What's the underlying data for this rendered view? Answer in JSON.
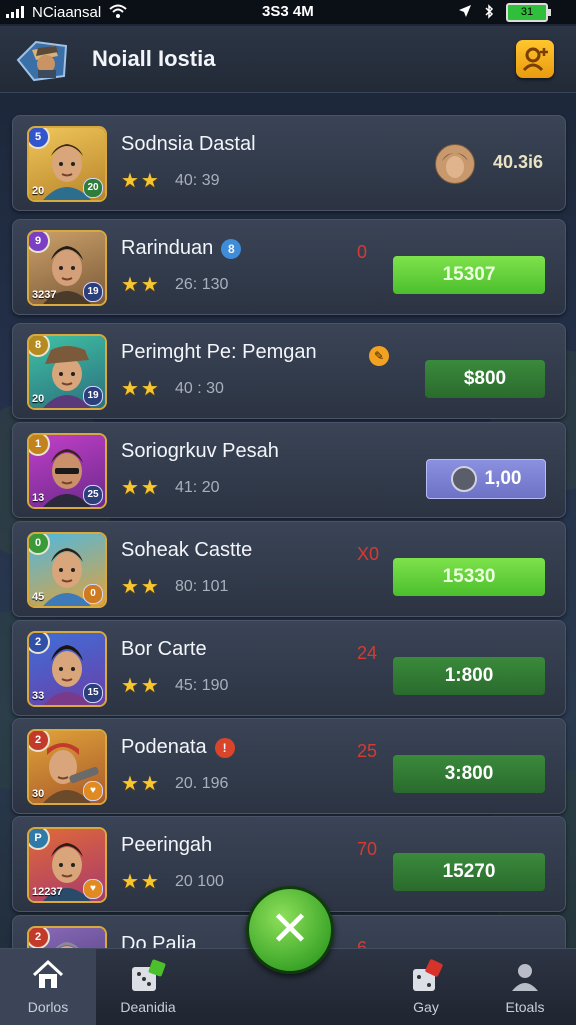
{
  "status_bar": {
    "carrier": "NCiaansal",
    "time": "3S3 4M",
    "battery": "31"
  },
  "header": {
    "title": "Noiall Iostia",
    "profile_icon": "user-icon"
  },
  "rows": [
    {
      "name": "Sodnsia Dastal",
      "stars": "★★",
      "score": "40: 39",
      "level": "5",
      "av_left": "20",
      "av_right": "20",
      "change": "",
      "action": "40.3i6",
      "action_style": "plain",
      "tag": ""
    },
    {
      "name": "Rarinduan",
      "stars": "★★",
      "score": "26: 130",
      "level": "9",
      "av_left": "3237",
      "av_right": "19",
      "change": "0",
      "action": "15307",
      "action_style": "bright",
      "tag": "8"
    },
    {
      "name": "Perimght Pe: Pemgan",
      "stars": "★★",
      "score": "40 : 30",
      "level": "8",
      "av_left": "20",
      "av_right": "19",
      "change": "",
      "action": "$800",
      "action_style": "dark",
      "tag": "✎"
    },
    {
      "name": "Soriogrkuv Pesah",
      "stars": "★★",
      "score": "41: 20",
      "level": "1",
      "av_left": "13",
      "av_right": "25",
      "change": "",
      "action": "1,00",
      "action_style": "purple",
      "tag": ""
    },
    {
      "name": "Soheak Castte",
      "stars": "★★",
      "score": "80: 101",
      "level": "0",
      "av_left": "45",
      "av_right": "0",
      "change": "X0",
      "action": "15330",
      "action_style": "bright",
      "tag": ""
    },
    {
      "name": "Bor Carte",
      "stars": "★★",
      "score": "45: 190",
      "level": "2",
      "av_left": "33",
      "av_right": "15",
      "change": "24",
      "action": "1:800",
      "action_style": "dark",
      "tag": ""
    },
    {
      "name": "Podenata",
      "stars": "★★",
      "score": "20. 196",
      "level": "2",
      "av_left": "30",
      "av_right": "♥",
      "change": "25",
      "action": "3:800",
      "action_style": "dark",
      "tag": "!"
    },
    {
      "name": "Peeringah",
      "stars": "★★",
      "score": "20 100",
      "level": "P",
      "av_left": "12237",
      "av_right": "♥",
      "change": "70",
      "action": "15270",
      "action_style": "dark",
      "tag": ""
    },
    {
      "name": "Do Palia",
      "stars": "",
      "score": "",
      "level": "2",
      "av_left": "",
      "av_right": "",
      "change": "6",
      "action": "",
      "action_style": "none",
      "tag": ""
    }
  ],
  "fab": {
    "icon": "close-icon",
    "glyph": "✕"
  },
  "nav": [
    {
      "label": "Dorlos",
      "icon": "home-icon",
      "active": true
    },
    {
      "label": "Deanidia",
      "icon": "dice-icon",
      "active": false
    },
    {
      "label": "Gay",
      "icon": "gift-box-icon",
      "active": false
    },
    {
      "label": "Etoals",
      "icon": "person-icon",
      "active": false
    }
  ],
  "colors": {
    "accent_green": "#5ccf34",
    "gold": "#f7c630",
    "loss_red": "#d53b33",
    "profile_button": "#f2b320"
  }
}
